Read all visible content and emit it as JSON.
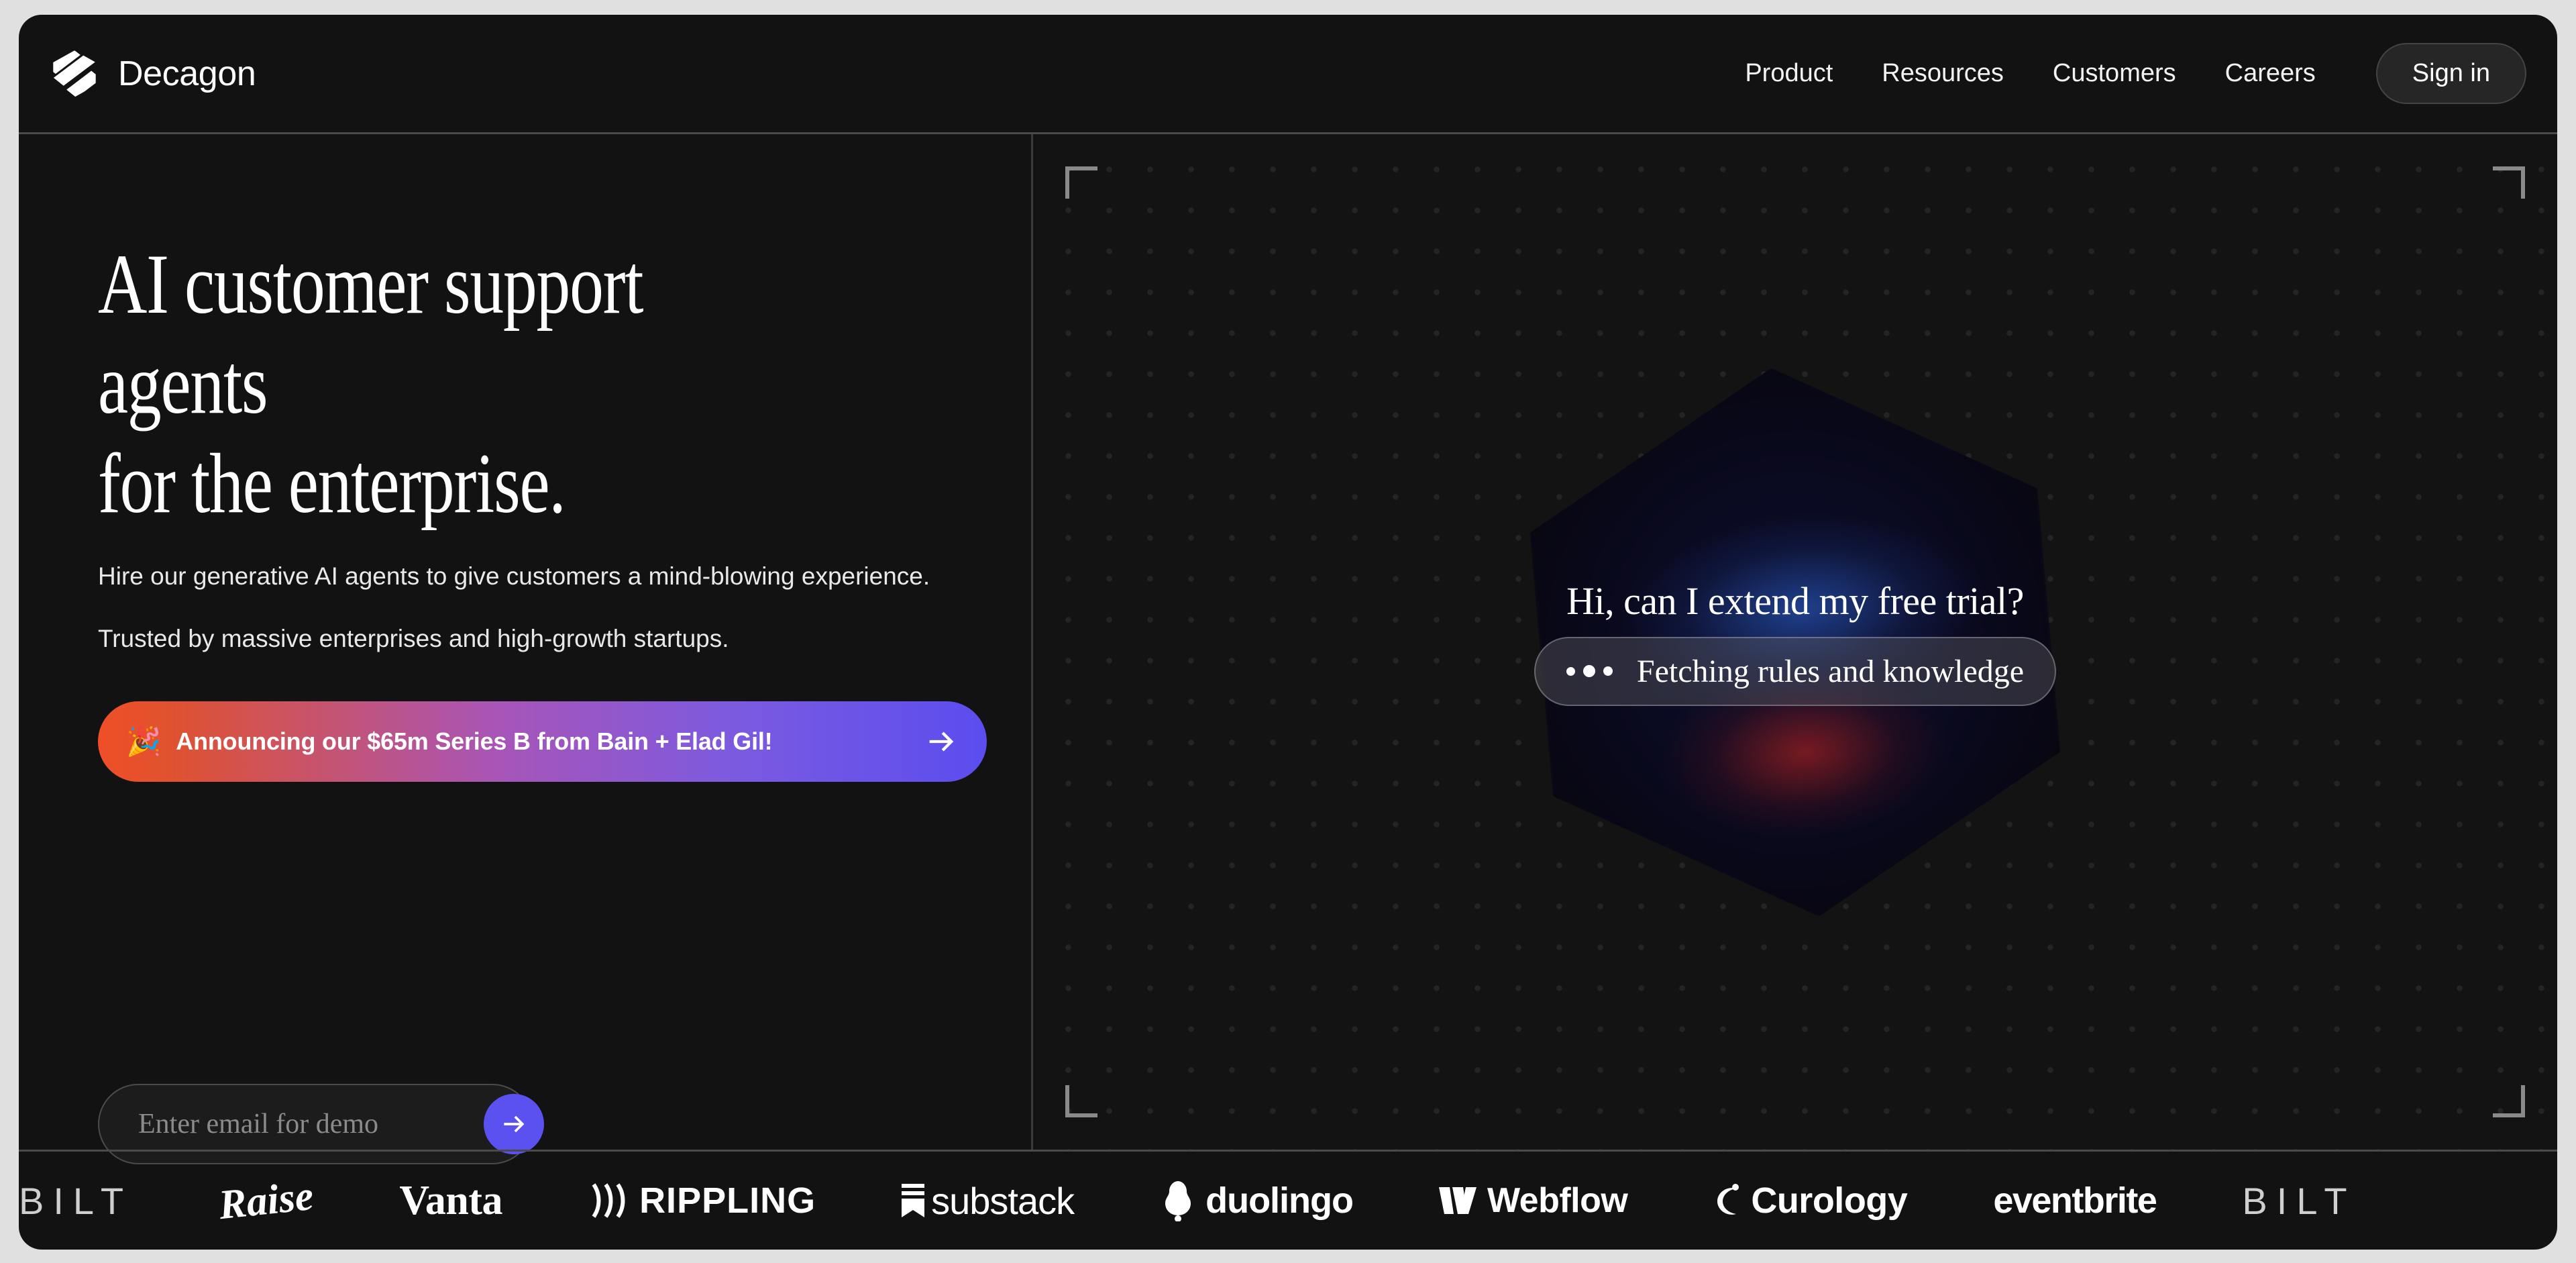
{
  "brand": {
    "name": "Decagon",
    "logo_icon": "decagon-hexagon-logo"
  },
  "nav": {
    "links": [
      {
        "label": "Product"
      },
      {
        "label": "Resources"
      },
      {
        "label": "Customers"
      },
      {
        "label": "Careers"
      }
    ],
    "signin_label": "Sign in"
  },
  "hero": {
    "headline_line1": "AI customer support agents",
    "headline_line2": "for the enterprise.",
    "subcopy_line1": "Hire our generative AI agents to give customers a mind-blowing experience.",
    "subcopy_line2": "Trusted by massive enterprises and high-growth startups.",
    "announcement": {
      "emoji": "🎉",
      "text": "Announcing our $65m Series B from Bain + Elad Gil!",
      "arrow_icon": "arrow-right-icon",
      "gradient_start": "#ef4f27",
      "gradient_mid": "#a855b8",
      "gradient_end": "#5b4def"
    },
    "email": {
      "placeholder": "Enter email for demo",
      "value": "",
      "submit_icon": "arrow-right-icon",
      "submit_color": "#5b51f0"
    }
  },
  "demo": {
    "question": "Hi, can I extend my free trial?",
    "status": "Fetching rules and knowledge",
    "loading_icon": "three-dots-loading-icon",
    "brackets": [
      "corner-bracket-top-left",
      "corner-bracket-top-right",
      "corner-bracket-bottom-left",
      "corner-bracket-bottom-right"
    ]
  },
  "logos": [
    {
      "name": "BILT",
      "label": "BILT",
      "style": "lg-bilt"
    },
    {
      "name": "Raise",
      "label": "Raise",
      "style": "lg-raise"
    },
    {
      "name": "Vanta",
      "label": "Vanta",
      "style": "lg-vanta"
    },
    {
      "name": "Rippling",
      "label": "RIPPLING",
      "style": "lg-rippling"
    },
    {
      "name": "Substack",
      "label": "substack",
      "style": "lg-substack"
    },
    {
      "name": "Duolingo",
      "label": "duolingo",
      "style": "lg-duolingo"
    },
    {
      "name": "Webflow",
      "label": "Webflow",
      "style": "lg-webflow"
    },
    {
      "name": "Curology",
      "label": "Curology",
      "style": "lg-curology"
    },
    {
      "name": "Eventbrite",
      "label": "eventbrite",
      "style": "lg-eventbrite"
    },
    {
      "name": "BILT",
      "label": "BILT",
      "style": "lg-bilt"
    }
  ]
}
